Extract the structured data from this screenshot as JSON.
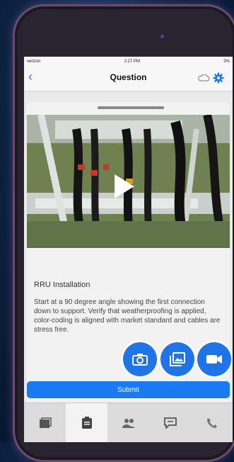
{
  "status_bar": {
    "carrier": "verizon",
    "time": "2:27 PM",
    "battery": "3%"
  },
  "nav": {
    "title": "Question",
    "back_icon": "chevron-left-icon",
    "cloud_icon": "cloud-icon",
    "settings_icon": "gear-icon"
  },
  "question": {
    "title": "RRU Installation",
    "body": "Start at a 90 degree angle showing the first connection down to support. Verify that weatherproofing is applied, color-coding is aligned with market standard and cables are stress free."
  },
  "actions": {
    "camera_icon": "camera-icon",
    "gallery_icon": "gallery-icon",
    "video_icon": "video-icon"
  },
  "submit_label": "Submit",
  "tabs": [
    {
      "icon": "library-icon",
      "active": false
    },
    {
      "icon": "clipboard-icon",
      "active": true
    },
    {
      "icon": "people-icon",
      "active": false
    },
    {
      "icon": "chat-icon",
      "active": false
    },
    {
      "icon": "phone-icon",
      "active": false
    }
  ],
  "colors": {
    "accent": "#1a7bf0",
    "fab": "#1f74e8"
  }
}
